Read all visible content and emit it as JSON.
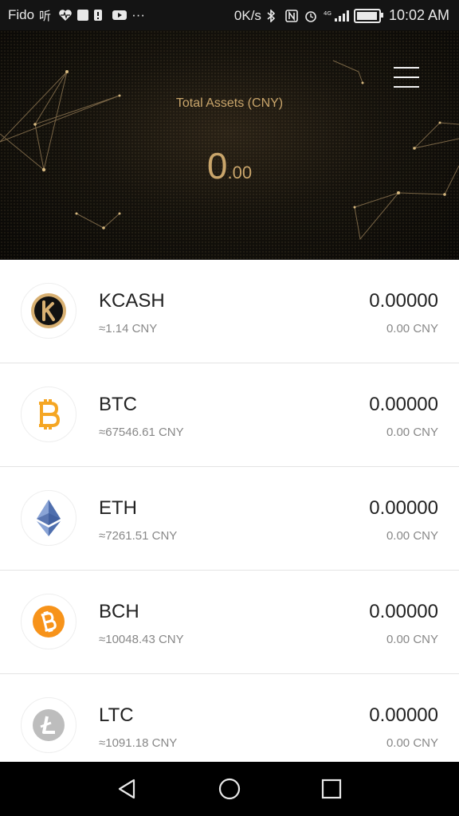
{
  "status_bar": {
    "carrier": "Fido",
    "speed": "0K/s",
    "network": "4G",
    "time": "10:02 AM"
  },
  "header": {
    "total_label": "Total Assets (CNY)",
    "total_int": "0",
    "total_dec": ".00",
    "accent_color": "#c9a56b"
  },
  "coins": [
    {
      "symbol": "KCASH",
      "rate": "≈1.14 CNY",
      "balance": "0.00000",
      "value_cny": "0.00 CNY",
      "icon": "kcash-icon",
      "color": "#c9a56b"
    },
    {
      "symbol": "BTC",
      "rate": "≈67546.61 CNY",
      "balance": "0.00000",
      "value_cny": "0.00 CNY",
      "icon": "bitcoin-icon",
      "color": "#f5a623"
    },
    {
      "symbol": "ETH",
      "rate": "≈7261.51 CNY",
      "balance": "0.00000",
      "value_cny": "0.00 CNY",
      "icon": "ethereum-icon",
      "color": "#5a7cb8"
    },
    {
      "symbol": "BCH",
      "rate": "≈10048.43 CNY",
      "balance": "0.00000",
      "value_cny": "0.00 CNY",
      "icon": "bitcoin-cash-icon",
      "color": "#f7931a"
    },
    {
      "symbol": "LTC",
      "rate": "≈1091.18 CNY",
      "balance": "0.00000",
      "value_cny": "0.00 CNY",
      "icon": "litecoin-icon",
      "color": "#bcbcbc"
    }
  ],
  "nav": {
    "back_icon": "back-triangle-icon",
    "home_icon": "home-circle-icon",
    "recents_icon": "recents-square-icon"
  }
}
